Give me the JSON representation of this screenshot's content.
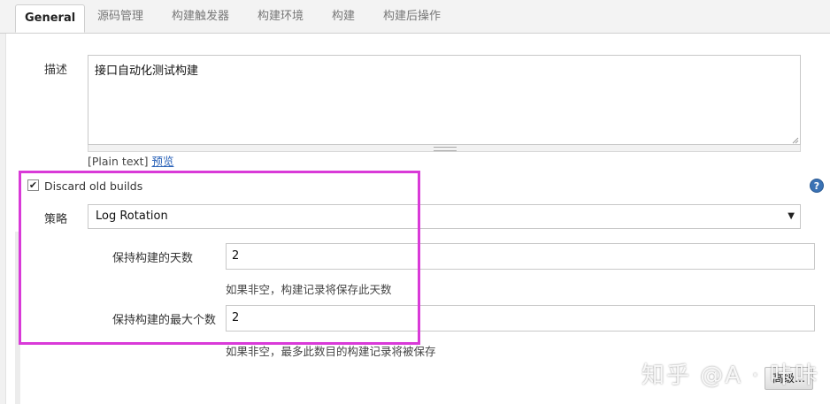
{
  "tabs": [
    {
      "label": "General",
      "active": true
    },
    {
      "label": "源码管理"
    },
    {
      "label": "构建触发器"
    },
    {
      "label": "构建环境"
    },
    {
      "label": "构建"
    },
    {
      "label": "构建后操作"
    }
  ],
  "description": {
    "label": "描述",
    "value": "接口自动化测试构建",
    "format_text": "[Plain text]",
    "preview_link": "预览"
  },
  "discard": {
    "checked": true,
    "check_mark": "✔",
    "label": "Discard old builds",
    "help_glyph": "?"
  },
  "strategy": {
    "label": "策略",
    "selected": "Log Rotation",
    "arrow": "▼"
  },
  "days": {
    "label": "保持构建的天数",
    "value": "2",
    "hint": "如果非空，构建记录将保存此天数"
  },
  "max_builds": {
    "label": "保持构建的最大个数",
    "value": "2",
    "hint": "如果非空，最多此数目的构建记录将被保存"
  },
  "advanced_button": "高级...",
  "watermark": "知乎 @A · 咔咔",
  "colors": {
    "highlight": "#d93ad8",
    "link": "#2a62b8",
    "help": "#3a72b5"
  }
}
